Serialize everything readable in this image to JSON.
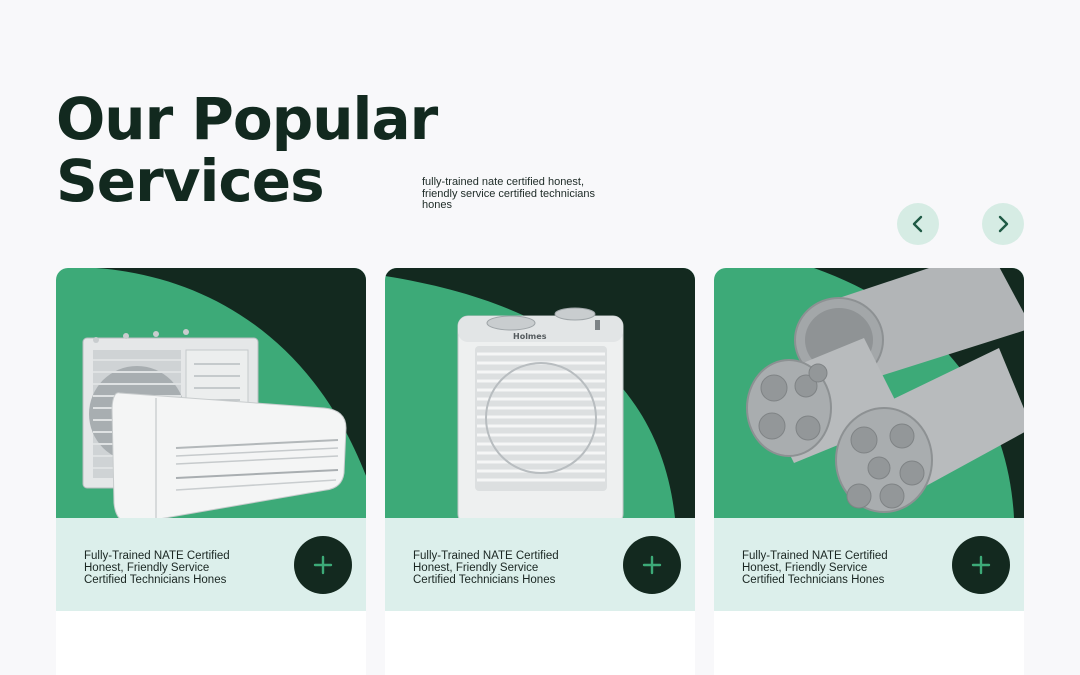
{
  "section": {
    "title_line1": "Our Popular",
    "title_line2": "Services",
    "description": "fully-trained nate certified honest, friendly service certified technicians hones"
  },
  "navigation": {
    "prev_icon": "chevron-left-icon",
    "next_icon": "chevron-right-icon"
  },
  "cards": [
    {
      "image": "air-conditioner-image",
      "text_line1": "Fully-Trained NATE Certified",
      "text_line2": "Honest, Friendly Service",
      "text_line3": "Certified Technicians Hones",
      "action_icon": "plus-icon"
    },
    {
      "image": "space-heater-image",
      "text_line1": "Fully-Trained NATE Certified",
      "text_line2": "Honest, Friendly Service",
      "text_line3": "Certified Technicians Hones",
      "action_icon": "plus-icon"
    },
    {
      "image": "pipes-image",
      "text_line1": "Fully-Trained NATE Certified",
      "text_line2": "Honest, Friendly Service",
      "text_line3": "Certified Technicians Hones",
      "action_icon": "plus-icon"
    }
  ],
  "colors": {
    "dark_green": "#13291f",
    "accent_green": "#3daa78",
    "light_mint": "#dcefeb",
    "nav_button_bg": "#d6ece4",
    "page_bg": "#f8f8fa"
  }
}
